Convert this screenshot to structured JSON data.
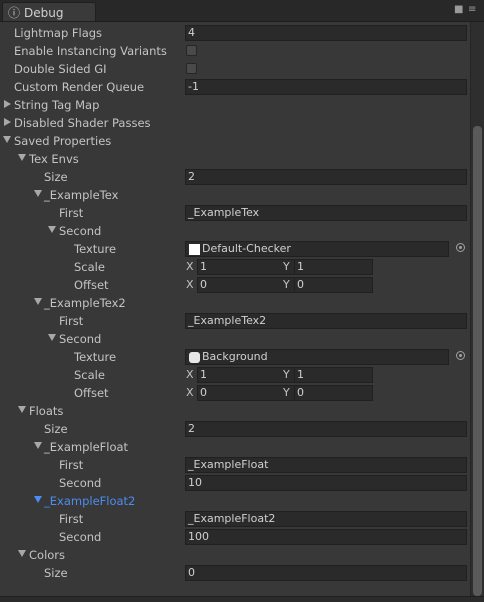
{
  "tab": {
    "icon": "debug-icon",
    "label": "Debug"
  },
  "header_icons": {
    "lock": "🔒",
    "menu": "≡"
  },
  "rows": {
    "lightmap_flags": {
      "label": "Lightmap Flags",
      "value": "4"
    },
    "enable_instancing": {
      "label": "Enable Instancing Variants",
      "checked": false
    },
    "double_sided_gi": {
      "label": "Double Sided GI",
      "checked": false
    },
    "custom_render_queue": {
      "label": "Custom Render Queue",
      "value": "-1"
    },
    "string_tag_map": {
      "label": "String Tag Map"
    },
    "disabled_shader_passes": {
      "label": "Disabled Shader Passes"
    },
    "saved_properties": {
      "label": "Saved Properties"
    },
    "tex_envs": {
      "label": "Tex Envs"
    },
    "tex_envs_size": {
      "label": "Size",
      "value": "2"
    },
    "example_tex": {
      "label": "_ExampleTex"
    },
    "example_tex_first": {
      "label": "First",
      "value": "_ExampleTex"
    },
    "example_tex_second": {
      "label": "Second"
    },
    "example_tex_texture": {
      "label": "Texture",
      "value": "Default-Checker"
    },
    "example_tex_scale": {
      "label": "Scale",
      "x_label": "X",
      "x": "1",
      "y_label": "Y",
      "y": "1"
    },
    "example_tex_offset": {
      "label": "Offset",
      "x_label": "X",
      "x": "0",
      "y_label": "Y",
      "y": "0"
    },
    "example_tex2": {
      "label": "_ExampleTex2"
    },
    "example_tex2_first": {
      "label": "First",
      "value": "_ExampleTex2"
    },
    "example_tex2_second": {
      "label": "Second"
    },
    "example_tex2_texture": {
      "label": "Texture",
      "value": "Background"
    },
    "example_tex2_scale": {
      "label": "Scale",
      "x_label": "X",
      "x": "1",
      "y_label": "Y",
      "y": "1"
    },
    "example_tex2_offset": {
      "label": "Offset",
      "x_label": "X",
      "x": "0",
      "y_label": "Y",
      "y": "0"
    },
    "floats": {
      "label": "Floats"
    },
    "floats_size": {
      "label": "Size",
      "value": "2"
    },
    "example_float": {
      "label": "_ExampleFloat"
    },
    "example_float_first": {
      "label": "First",
      "value": "_ExampleFloat"
    },
    "example_float_second": {
      "label": "Second",
      "value": "10"
    },
    "example_float2": {
      "label": "_ExampleFloat2"
    },
    "example_float2_first": {
      "label": "First",
      "value": "_ExampleFloat2"
    },
    "example_float2_second": {
      "label": "Second",
      "value": "100"
    },
    "colors": {
      "label": "Colors"
    },
    "colors_size": {
      "label": "Size",
      "value": "0"
    }
  },
  "colors": {
    "background": "#383838",
    "field": "#2a2a2a",
    "text": "#c4c4c4",
    "selected_text": "#4d8cf0"
  }
}
